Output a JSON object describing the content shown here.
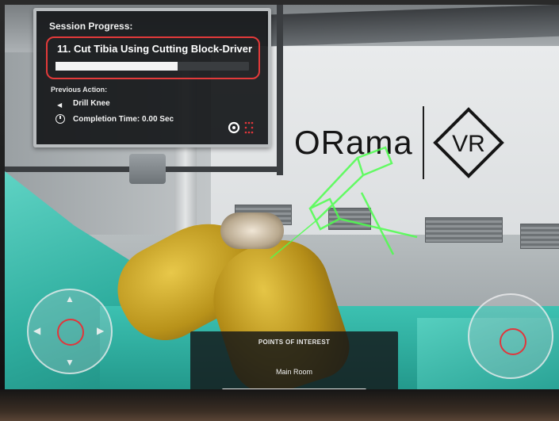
{
  "brand": {
    "logo_text": "ORama",
    "logo_mark": "VR"
  },
  "session_panel": {
    "title": "Session Progress:",
    "current_step": "11. Cut Tibia Using Cutting Block-Driver",
    "step_progress": 0.63,
    "previous_action_label": "Previous Action:",
    "previous_action": "Drill Knee",
    "completion_time": "Completion Time: 0.00 Sec",
    "icons": [
      "play-left-icon",
      "clock-icon",
      "points-of-interest-icon"
    ]
  },
  "points_of_interest": {
    "title": "POINTS OF INTEREST",
    "item": "Main Room"
  },
  "controls": {
    "left_joystick_icons": [
      "arrow-up-icon",
      "arrow-down-icon",
      "arrow-left-icon",
      "arrow-right-icon"
    ],
    "accent_color": "#e1363b"
  },
  "colors": {
    "panel_bg": "#16181a",
    "highlight_border": "#e33a3a",
    "laser": "#4dff4d",
    "drape": "#2fae9f"
  }
}
